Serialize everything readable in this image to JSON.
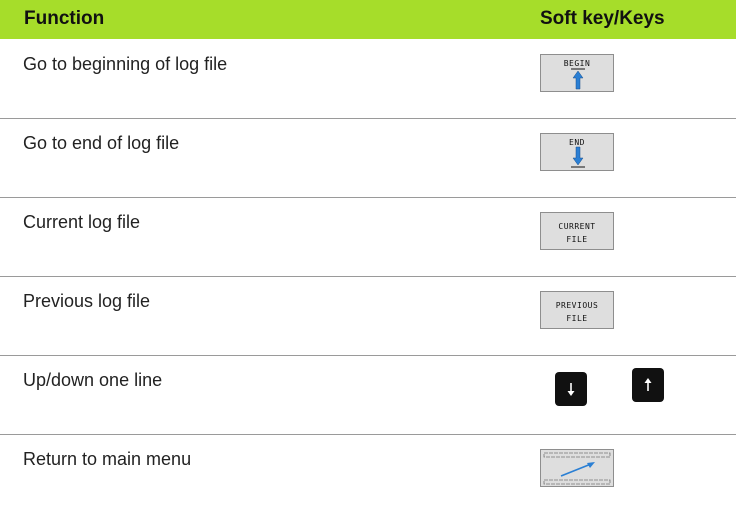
{
  "header": {
    "function": "Function",
    "keys": "Soft key/Keys"
  },
  "rows": [
    {
      "label": "Go to beginning of log file",
      "key": "BEGIN",
      "icon": "arrow-up-bar-icon"
    },
    {
      "label": "Go to end of log file",
      "key": "END",
      "icon": "arrow-down-bar-icon"
    },
    {
      "label": "Current log file",
      "key_line1": "CURRENT",
      "key_line2": "FILE"
    },
    {
      "label": "Previous log file",
      "key_line1": "PREVIOUS",
      "key_line2": "FILE"
    },
    {
      "label": "Up/down one line",
      "icons": [
        "arrow-down-key-icon",
        "arrow-up-key-icon"
      ]
    },
    {
      "label": "Return to main menu",
      "icon": "main-menu-arrow-icon"
    }
  ],
  "colors": {
    "header_background": "#a6dd2a",
    "softkey_background": "#dedede",
    "arrow_blue": "#2a7fd4",
    "separator": "#9a9a9a"
  }
}
